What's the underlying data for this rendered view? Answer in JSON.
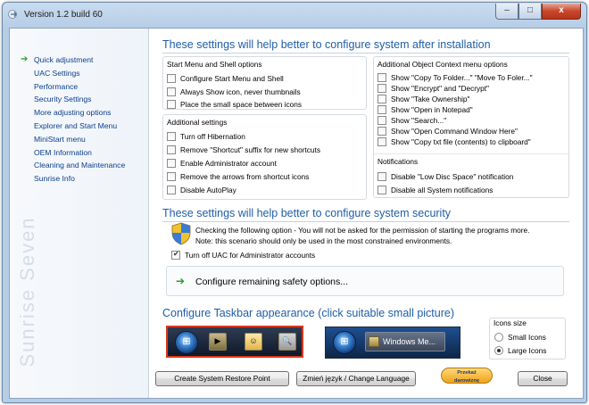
{
  "window": {
    "title": "Version 1.2 build 60",
    "controls": {
      "minimize": "–",
      "maximize": "□",
      "close": "x"
    }
  },
  "sidebar": {
    "items": [
      {
        "label": "Quick adjustment",
        "active": true
      },
      {
        "label": "UAC Settings"
      },
      {
        "label": "Performance"
      },
      {
        "label": "Security Settings"
      },
      {
        "label": "More adjusting options"
      },
      {
        "label": "Explorer and Start Menu"
      },
      {
        "label": "MiniStart menu"
      },
      {
        "label": "OEM Information"
      },
      {
        "label": "Cleaning and Maintenance"
      },
      {
        "label": "Sunrise Info"
      }
    ],
    "watermark": "Sunrise Seven"
  },
  "install_section": {
    "title": "These settings will help better to configure system after installation",
    "start_menu": {
      "label": "Start Menu and Shell options",
      "options": [
        {
          "label": "Configure Start Menu and Shell",
          "checked": false
        },
        {
          "label": "Always Show icon, never thumbnails",
          "checked": false
        },
        {
          "label": "Place the small space between icons",
          "checked": false
        }
      ]
    },
    "additional": {
      "label": "Additional settings",
      "options": [
        {
          "label": "Turn off Hibernation",
          "checked": false
        },
        {
          "label": "Remove \"Shortcut\" suffix for new shortcuts",
          "checked": false
        },
        {
          "label": "Enable Administrator account",
          "checked": false
        },
        {
          "label": "Remove the arrows from shortcut icons",
          "checked": false
        },
        {
          "label": "Disable AutoPlay",
          "checked": false
        }
      ]
    },
    "context_menu": {
      "label": "Additional Object Context menu options",
      "options": [
        {
          "label": "Show \"Copy To Folder...\" \"Move To Foler...\"",
          "checked": false
        },
        {
          "label": "Show \"Encrypt\" and \"Decrypt\"",
          "checked": false
        },
        {
          "label": "Show \"Take Ownership\"",
          "checked": false
        },
        {
          "label": "Show \"Open in Notepad\"",
          "checked": false
        },
        {
          "label": "Show \"Search...\"",
          "checked": false
        },
        {
          "label": "Show \"Open Command Window Here\"",
          "checked": false
        },
        {
          "label": "Show \"Copy txt file (contents) to clipboard\"",
          "checked": false
        }
      ]
    },
    "notifications": {
      "label": "Notifications",
      "options": [
        {
          "label": "Disable \"Low Disc Space\" notification",
          "checked": false
        },
        {
          "label": "Disable all System notifications",
          "checked": false
        }
      ]
    }
  },
  "security_section": {
    "title": "These settings will help better to configure system security",
    "note_line1": "Checking the following option - You will not be asked for the permission of starting the programs more.",
    "note_line2": "Note: this scenario should only be used in the most constrained environments.",
    "uac_option": {
      "label": "Turn off UAC for Administrator accounts",
      "checked": true
    },
    "safety_link": "Configure remaining safety options..."
  },
  "taskbar_section": {
    "title": "Configure Taskbar appearance (click suitable small picture)",
    "preview2_label": "Windows Me...",
    "icons_size": {
      "label": "Icons size",
      "options": [
        {
          "label": "Small Icons",
          "selected": false
        },
        {
          "label": "Large Icons",
          "selected": true
        }
      ]
    }
  },
  "footer": {
    "restore_point": "Create System Restore Point",
    "change_language": "Zmień język / Change Language",
    "donate_line1": "Przekaż",
    "donate_line2": "darowiznę",
    "close": "Close"
  },
  "colors": {
    "section_title": "#1f5ea8",
    "nav_link": "#0b3f8c",
    "arrow": "#2e9a2e",
    "selected_taskbar_border": "#d9381e"
  }
}
